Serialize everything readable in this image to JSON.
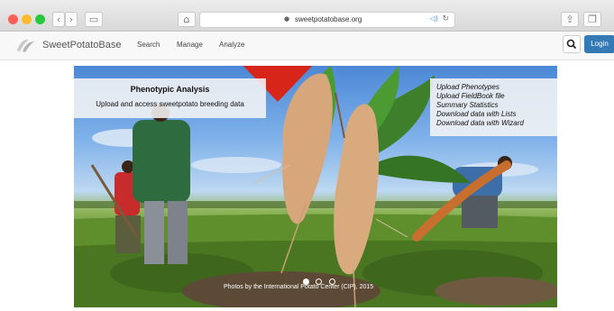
{
  "browser": {
    "url": "sweetpotatobase.org"
  },
  "navbar": {
    "brand": "SweetPotatoBase",
    "items": [
      {
        "label": "Search"
      },
      {
        "label": "Manage"
      },
      {
        "label": "Analyze"
      }
    ],
    "login_label": "Login"
  },
  "hero": {
    "left_caption": {
      "title": "Phenotypic Analysis",
      "subtitle": "Upload and access sweetpotato breeding data"
    },
    "right_caption": {
      "items": [
        "Upload Phenotypes",
        "Upload FieldBook file",
        "Summary Statistics",
        "Download data with Lists",
        "Download data with Wizard"
      ]
    },
    "credit": "Photos by the International Potato Center (CIP), 2015",
    "slide_count": 3,
    "active_slide": 1
  },
  "annotation": {
    "arrow_color": "#d8251a"
  }
}
